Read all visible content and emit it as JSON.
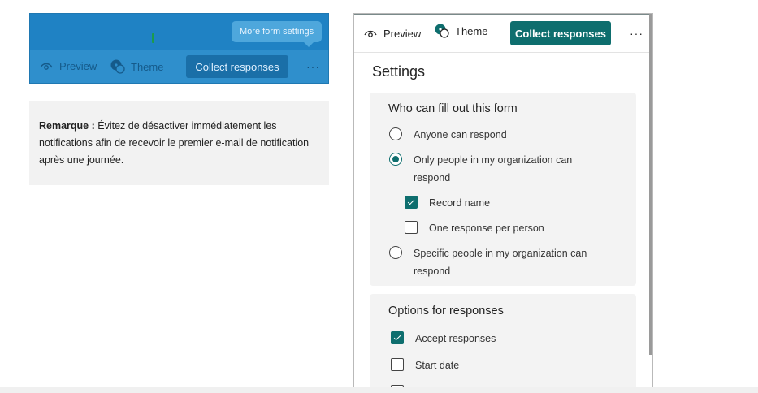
{
  "left_toolbar": {
    "tooltip": "More form settings",
    "preview_label": "Preview",
    "theme_label": "Theme",
    "collect_label": "Collect responses",
    "more_label": "···"
  },
  "note": {
    "label": "Remarque :",
    "text": " Évitez de désactiver immédiatement les notifications afin de recevoir le premier e-mail de notification après une journée."
  },
  "right_toolbar": {
    "preview_label": "Preview",
    "theme_label": "Theme",
    "collect_label": "Collect responses",
    "more_label": "···"
  },
  "settings": {
    "title": "Settings",
    "who_section": {
      "title": "Who can fill out this form",
      "options": [
        {
          "label": "Anyone can respond",
          "checked": false
        },
        {
          "label": "Only people in my organization can respond",
          "checked": true
        },
        {
          "label": "Specific people in my organization can respond",
          "checked": false
        }
      ],
      "sub_options": [
        {
          "label": "Record name",
          "checked": true
        },
        {
          "label": "One response per person",
          "checked": false
        }
      ]
    },
    "responses_section": {
      "title": "Options for responses",
      "options": [
        {
          "label": "Accept responses",
          "checked": true
        },
        {
          "label": "Start date",
          "checked": false
        }
      ]
    }
  },
  "colors": {
    "accent": "#0e6e6e",
    "left_highlight": "#2f8fcc"
  }
}
